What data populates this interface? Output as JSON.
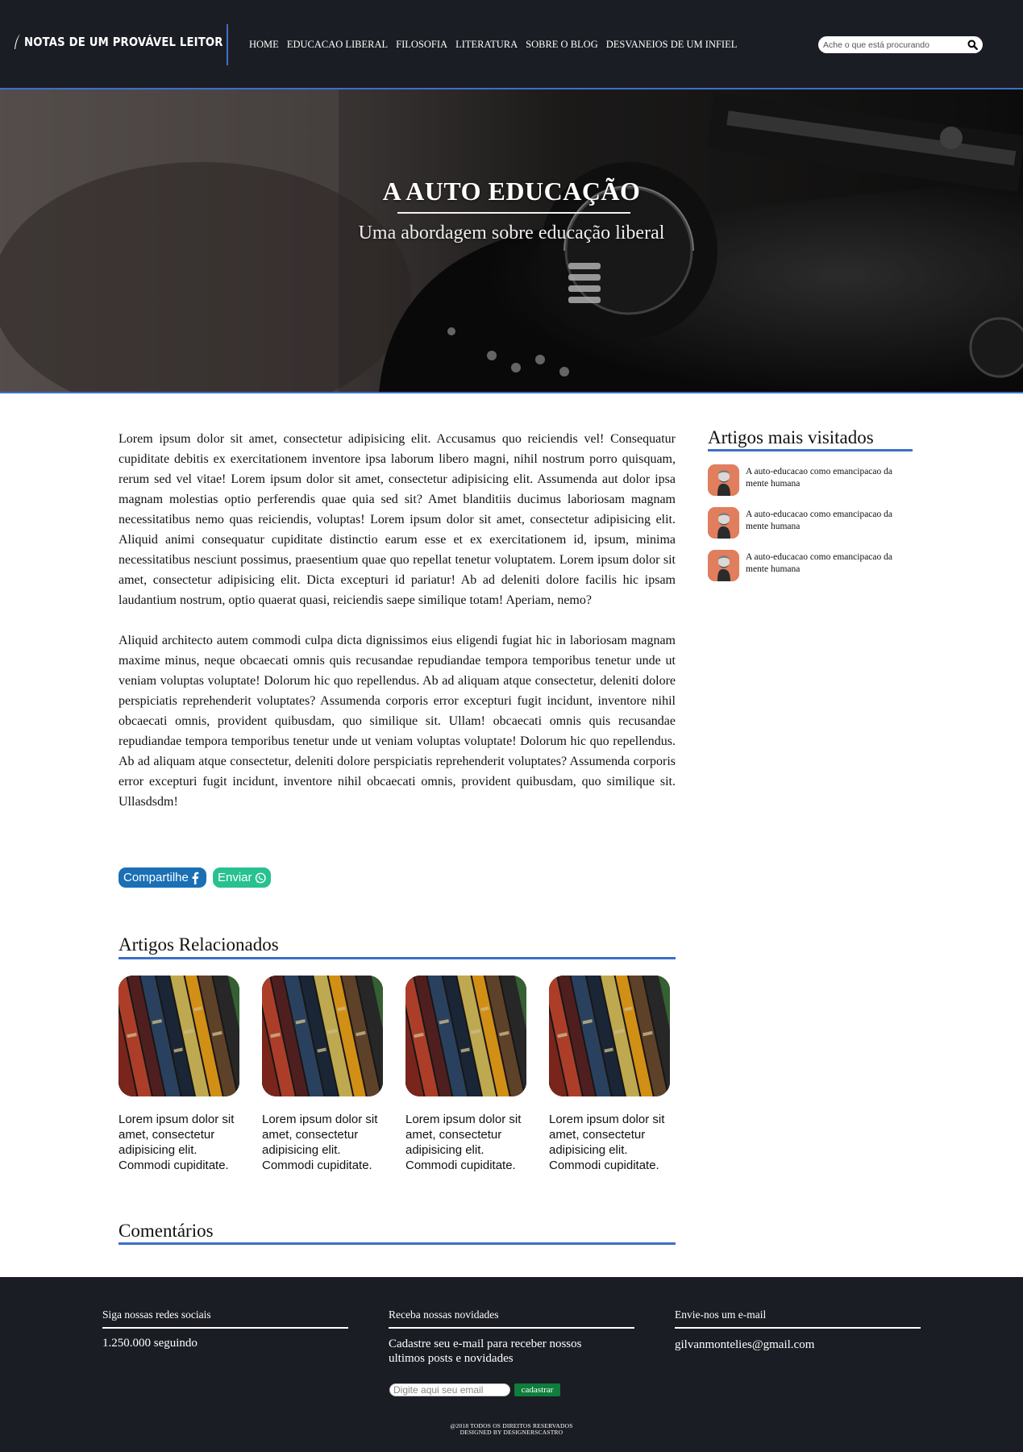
{
  "header": {
    "logo_text": "NOTAS DE UM PROVÁVEL LEITOR",
    "nav": [
      "HOME",
      "EDUCACAO LIBERAL",
      "FILOSOFIA",
      "LITERATURA",
      "SOBRE O BLOG",
      "DESVANEIOS DE UM INFIEL"
    ],
    "search_placeholder": "Ache o que está procurando"
  },
  "hero": {
    "title": "A AUTO EDUCAÇÃO",
    "subtitle": "Uma abordagem sobre educação liberal"
  },
  "article": {
    "paragraphs": [
      "Lorem ipsum dolor sit amet, consectetur adipisicing elit. Accusamus quo reiciendis vel! Consequatur cupiditate debitis ex exercitationem inventore ipsa laborum libero magni, nihil nostrum porro quisquam, rerum sed vel vitae! Lorem ipsum dolor sit amet, consectetur adipisicing elit. Assumenda aut dolor ipsa magnam molestias optio perferendis quae quia sed sit? Amet blanditiis ducimus laboriosam magnam necessitatibus nemo quas reiciendis, voluptas! Lorem ipsum dolor sit amet, consectetur adipisicing elit. Aliquid animi consequatur cupiditate distinctio earum esse et ex exercitationem id, ipsum, minima necessitatibus nesciunt possimus, praesentium quae quo repellat tenetur voluptatem. Lorem ipsum dolor sit amet, consectetur adipisicing elit. Dicta excepturi id pariatur! Ab ad deleniti dolore facilis hic ipsam laudantium nostrum, optio quaerat quasi, reiciendis saepe similique totam! Aperiam, nemo?",
      "Aliquid architecto autem commodi culpa dicta dignissimos eius eligendi fugiat hic in laboriosam magnam maxime minus, neque obcaecati omnis quis recusandae repudiandae tempora temporibus tenetur unde ut veniam voluptas voluptate! Dolorum hic quo repellendus. Ab ad aliquam atque consectetur, deleniti dolore perspiciatis reprehenderit voluptates? Assumenda corporis error excepturi fugit incidunt, inventore nihil obcaecati omnis, provident quibusdam, quo similique sit. Ullam! obcaecati omnis quis recusandae repudiandae tempora temporibus tenetur unde ut veniam voluptas voluptate! Dolorum hic quo repellendus. Ab ad aliquam atque consectetur, deleniti dolore perspiciatis reprehenderit voluptates? Assumenda corporis error excepturi fugit incidunt, inventore nihil obcaecati omnis, provident quibusdam, quo similique sit. Ullasdsdm!"
    ],
    "share_facebook": "Compartilhe",
    "share_whatsapp": "Enviar"
  },
  "related": {
    "title": "Artigos Relacionados",
    "items": [
      {
        "text": "Lorem ipsum dolor sit amet, consectetur adipisicing elit. Commodi cupiditate."
      },
      {
        "text": "Lorem ipsum dolor sit amet, consectetur adipisicing elit. Commodi cupiditate."
      },
      {
        "text": "Lorem ipsum dolor sit amet, consectetur adipisicing elit. Commodi cupiditate."
      },
      {
        "text": "Lorem ipsum dolor sit amet, consectetur adipisicing elit. Commodi cupiditate."
      }
    ]
  },
  "comments": {
    "title": "Comentários"
  },
  "sidebar": {
    "title": "Artigos mais visitados",
    "items": [
      {
        "text": "A auto-educacao como emancipacao da mente humana"
      },
      {
        "text": "A auto-educacao como emancipacao da mente humana"
      },
      {
        "text": "A auto-educacao como emancipacao da mente humana"
      }
    ]
  },
  "footer": {
    "social_title": "Siga nossas redes sociais",
    "social_count": "1.250.000 seguindo",
    "news_title": "Receba nossas novidades",
    "news_text": "Cadastre seu e-mail para receber nossos ultimos posts e novidades",
    "news_placeholder": "Digite aqui seu email",
    "news_button": "cadastrar",
    "email_title": "Envie-nos um e-mail",
    "email_address": "gilvanmontelies@gmail.com",
    "copyright_1": "@2018 TODOS OS DIREITOS RESERVADOS",
    "copyright_2": "DESIGNED BY DESIGNERSCASTRO"
  },
  "colors": {
    "header_bg": "#1b1d24",
    "accent": "#3d6fc9",
    "facebook": "#1a6fb5",
    "whatsapp": "#28c190",
    "submit": "#0f7d3b"
  }
}
